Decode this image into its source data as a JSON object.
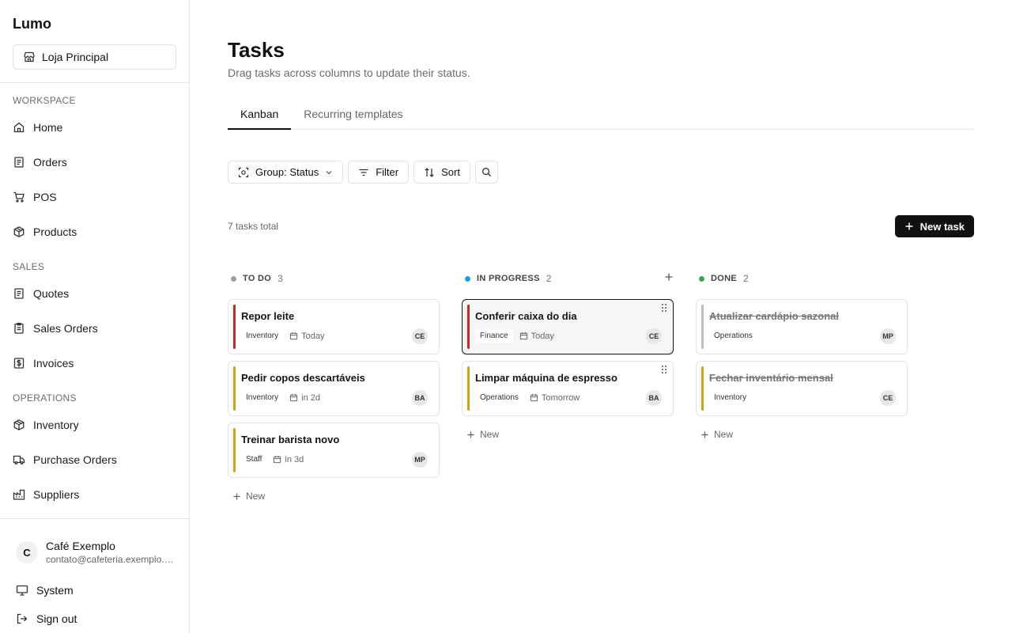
{
  "sidebar": {
    "brand": "Lumo",
    "store": "Loja Principal",
    "sections": {
      "workspace": "WORKSPACE",
      "sales": "SALES",
      "operations": "OPERATIONS"
    },
    "items": {
      "home": "Home",
      "orders": "Orders",
      "pos": "POS",
      "products": "Products",
      "quotes": "Quotes",
      "sales_orders": "Sales Orders",
      "invoices": "Invoices",
      "inventory": "Inventory",
      "purchase_orders": "Purchase Orders",
      "suppliers": "Suppliers"
    },
    "user": {
      "initial": "C",
      "name": "Café Exemplo",
      "email": "contato@cafeteria.exemplo.com"
    },
    "system": "System",
    "sign_out": "Sign out"
  },
  "page": {
    "title": "Tasks",
    "subtitle": "Drag tasks across columns to update their status.",
    "tabs": [
      "Kanban",
      "Recurring templates"
    ],
    "toolbar": {
      "group": "Group: Status",
      "filter": "Filter",
      "sort": "Sort"
    },
    "total": "7 tasks total",
    "new_task": "New task",
    "new_label": "New"
  },
  "columns": [
    {
      "title": "TO DO",
      "count": "3",
      "color": "#9e9e9e",
      "cards": [
        {
          "title": "Repor leite",
          "tag": "Inventory",
          "due": "Today",
          "assignee": "CE",
          "accent": "#c62828"
        },
        {
          "title": "Pedir copos descartáveis",
          "tag": "Inventory",
          "due": "in 2d",
          "assignee": "BA",
          "accent": "#d4a017"
        },
        {
          "title": "Treinar barista novo",
          "tag": "Staff",
          "due": "in 3d",
          "assignee": "MP",
          "accent": "#d4a017"
        }
      ]
    },
    {
      "title": "IN PROGRESS",
      "count": "2",
      "color": "#1e9be9",
      "cards": [
        {
          "title": "Conferir caixa do dia",
          "tag": "Finance",
          "due": "Today",
          "assignee": "CE",
          "accent": "#c62828"
        },
        {
          "title": "Limpar máquina de espresso",
          "tag": "Operations",
          "due": "Tomorrow",
          "assignee": "BA",
          "accent": "#d4a017"
        }
      ]
    },
    {
      "title": "DONE",
      "count": "2",
      "color": "#3aa757",
      "cards": [
        {
          "title": "Atualizar cardápio sazonal",
          "tag": "Operations",
          "assignee": "MP",
          "accent": "#bdbdbd"
        },
        {
          "title": "Fechar inventário mensal",
          "tag": "Inventory",
          "assignee": "CE",
          "accent": "#d4a017"
        }
      ]
    }
  ]
}
